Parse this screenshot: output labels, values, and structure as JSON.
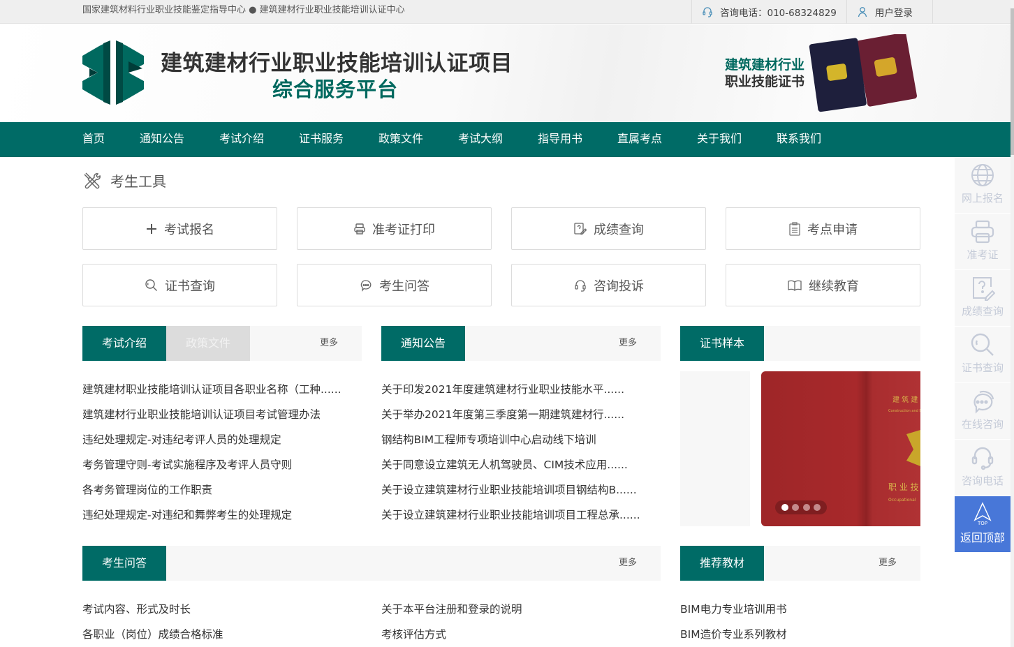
{
  "topbar": {
    "org_text": "国家建筑材料行业职业技能鉴定指导中心 ● 建筑建材行业职业技能培训认证中心",
    "phone": "咨询电话：010-68324829",
    "login": "用户登录"
  },
  "header": {
    "title_line1": "建筑建材行业职业技能培训认证项目",
    "title_line2": "综合服务平台",
    "cert_line1": "建筑建材行业",
    "cert_line2": "职业技能证书"
  },
  "nav": [
    "首页",
    "通知公告",
    "考试介绍",
    "证书服务",
    "政策文件",
    "考试大纲",
    "指导用书",
    "直属考点",
    "关于我们",
    "联系我们"
  ],
  "tools": {
    "title": "考生工具",
    "items": [
      {
        "label": "考试报名",
        "icon": "plus-icon"
      },
      {
        "label": "准考证打印",
        "icon": "printer-icon"
      },
      {
        "label": "成绩查询",
        "icon": "score-query-icon"
      },
      {
        "label": "考点申请",
        "icon": "clipboard-icon"
      },
      {
        "label": "证书查询",
        "icon": "search-icon"
      },
      {
        "label": "考生问答",
        "icon": "chat-icon"
      },
      {
        "label": "咨询投诉",
        "icon": "headset-icon"
      },
      {
        "label": "继续教育",
        "icon": "book-icon"
      }
    ]
  },
  "sections": {
    "exam": {
      "tab_active": "考试介绍",
      "tab_inactive": "政策文件",
      "more": "更多",
      "items": [
        "建筑建材职业技能培训认证项目各职业名称（工种......",
        "建筑建材行业职业技能培训认证项目考试管理办法",
        "违纪处理规定-对违纪考评人员的处理规定",
        "考务管理守则-考试实施程序及考评人员守则",
        "各考务管理岗位的工作职责",
        "违纪处理规定-对违纪和舞弊考生的处理规定"
      ]
    },
    "notice": {
      "tab": "通知公告",
      "more": "更多",
      "items": [
        "关于印发2021年度建筑建材行业职业技能水平......",
        "关于举办2021年度第三季度第一期建筑建材行......",
        "钢结构BIM工程师专项培训中心启动线下培训",
        "关于同意设立建筑无人机驾驶员、CIM技术应用......",
        "关于设立建筑建材行业职业技能培训项目钢结构B......",
        "关于设立建筑建材行业职业技能培训项目工程总承......"
      ]
    },
    "cert_sample": {
      "tab": "证书样本",
      "slide_count": 4,
      "active_slide": 1
    },
    "qa": {
      "tab": "考生问答",
      "more": "更多",
      "col1": [
        "考试内容、形式及时长",
        "各职业（岗位）成绩合格标准"
      ],
      "col2": [
        "关于本平台注册和登录的说明",
        "考核评估方式"
      ]
    },
    "books": {
      "tab": "推荐教材",
      "more": "更多",
      "items": [
        "BIM电力专业培训用书",
        "BIM造价专业系列教材"
      ]
    }
  },
  "sidebar": {
    "items": [
      "网上报名",
      "准考证",
      "成绩查询",
      "证书查询",
      "在线咨询",
      "咨询电话"
    ],
    "top_label": "返回顶部",
    "top_badge": "TOP"
  },
  "colors": {
    "brand": "#006b66",
    "accent_blue": "#4877d8",
    "sidebar_icon": "#c5cbd8"
  }
}
